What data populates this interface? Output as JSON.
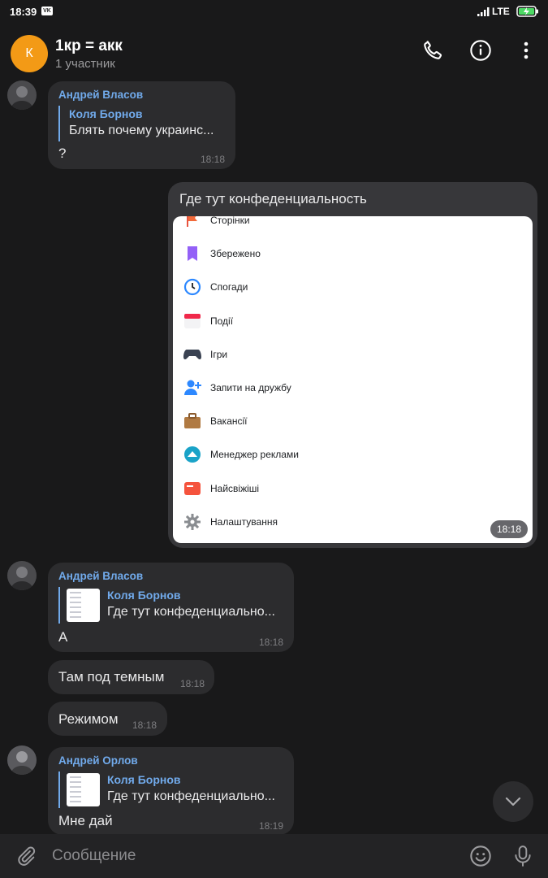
{
  "status_bar": {
    "time": "18:39",
    "vk_badge": "VK",
    "network": "LTE",
    "icons": [
      "vk-icon",
      "signal-icon",
      "battery-charging-icon"
    ]
  },
  "header": {
    "avatar_letter": "К",
    "avatar_color": "#f39a16",
    "title": "1кр = акк",
    "subtitle": "1 участник",
    "icons": [
      "phone-icon",
      "info-icon",
      "more-vertical-icon"
    ]
  },
  "messages": [
    {
      "sender": "Андрей Власов",
      "reply": {
        "author": "Коля Борнов",
        "text": "Блять почему украинс..."
      },
      "text": "?",
      "time": "18:18"
    },
    {
      "outgoing": true,
      "text": "Где тут конфеденциальность",
      "time": "18:18",
      "attachment": {
        "type": "screenshot",
        "menu": [
          {
            "label": "Сторінки",
            "icon": "flag-icon"
          },
          {
            "label": "Збережено",
            "icon": "bookmark-icon"
          },
          {
            "label": "Спогади",
            "icon": "clock-history-icon"
          },
          {
            "label": "Події",
            "icon": "calendar-icon"
          },
          {
            "label": "Ігри",
            "icon": "gamepad-icon"
          },
          {
            "label": "Запити на дружбу",
            "icon": "friend-request-icon"
          },
          {
            "label": "Вакансії",
            "icon": "briefcase-icon"
          },
          {
            "label": "Менеджер реклами",
            "icon": "ads-manager-icon"
          },
          {
            "label": "Найсвіжіші",
            "icon": "news-feed-icon"
          },
          {
            "label": "Налаштування",
            "icon": "gear-icon"
          }
        ]
      }
    },
    {
      "sender": "Андрей Власов",
      "reply": {
        "author": "Коля Борнов",
        "text": "Где тут конфеденциально..."
      },
      "text": "А",
      "time": "18:18"
    },
    {
      "text": "Там под темным",
      "time": "18:18"
    },
    {
      "text": "Режимом",
      "time": "18:18"
    },
    {
      "sender": "Андрей Орлов",
      "reply": {
        "author": "Коля Борнов",
        "text": "Где тут конфеденциально..."
      },
      "text": "Мне дай",
      "time": "18:19"
    }
  ],
  "composer": {
    "placeholder": "Сообщение",
    "icons": [
      "attach-icon",
      "emoji-icon",
      "microphone-icon"
    ]
  },
  "colors": {
    "background": "#19191a",
    "bubble": "#2c2c2e",
    "accent": "#71aaeb"
  }
}
